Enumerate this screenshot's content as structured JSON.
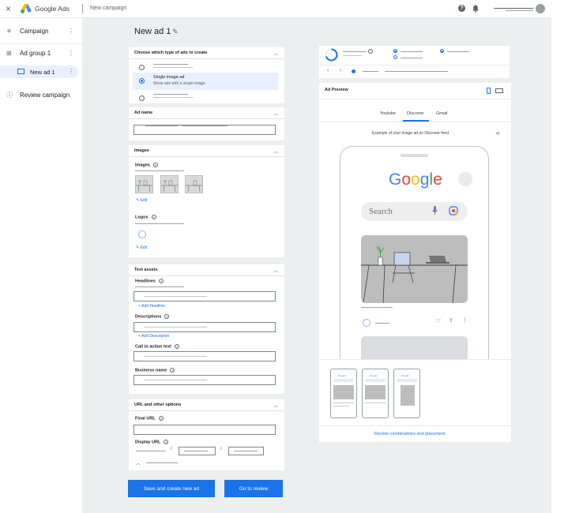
{
  "topbar": {
    "close_glyph": "×",
    "brand": "Google Ads",
    "breadcrumb": "New campaign",
    "help_glyph": "?"
  },
  "sidebar": {
    "items": [
      {
        "label": "Campaign",
        "icon": "asterisk-icon"
      },
      {
        "label": "Ad group 1",
        "icon": "grid-icon"
      },
      {
        "label": "New ad 1",
        "icon": "ad-icon"
      },
      {
        "label": "Review campaign",
        "icon": "info-icon"
      }
    ]
  },
  "main": {
    "title": "New ad 1",
    "type_card": {
      "header": "Choose which type of ads to create",
      "option_title": "Single image ad",
      "option_desc": "Show ads with a single image"
    },
    "adname_card": {
      "header": "Ad name"
    },
    "images_card": {
      "header": "Images",
      "images_label": "Images",
      "edit": "Edit",
      "logos_label": "Logos",
      "edit2": "Edit"
    },
    "text_card": {
      "header": "Text assets",
      "headlines": "Headlines",
      "add_headline": "Add Headline",
      "descriptions": "Descriptions",
      "add_description": "Add Description",
      "cta": "Call to action text",
      "business": "Business name"
    },
    "url_card": {
      "header": "URL and other options",
      "final_url": "Final URL",
      "display_url": "Display URL"
    },
    "buttons": {
      "save_new": "Save and create new ad",
      "review": "Go to review"
    }
  },
  "preview": {
    "title": "Ad Preview",
    "tabs": [
      "Youtube",
      "Discover",
      "Gmail"
    ],
    "active_tab": "Discover",
    "caption": "Example of your image ad on Discover feed",
    "google": [
      "G",
      "o",
      "o",
      "g",
      "l",
      "e"
    ],
    "google_colors": [
      "#4285f4",
      "#ea4335",
      "#fbbc05",
      "#4285f4",
      "#34a853",
      "#ea4335"
    ],
    "search_placeholder": "Search",
    "review_link": "Review combinations and placement"
  }
}
